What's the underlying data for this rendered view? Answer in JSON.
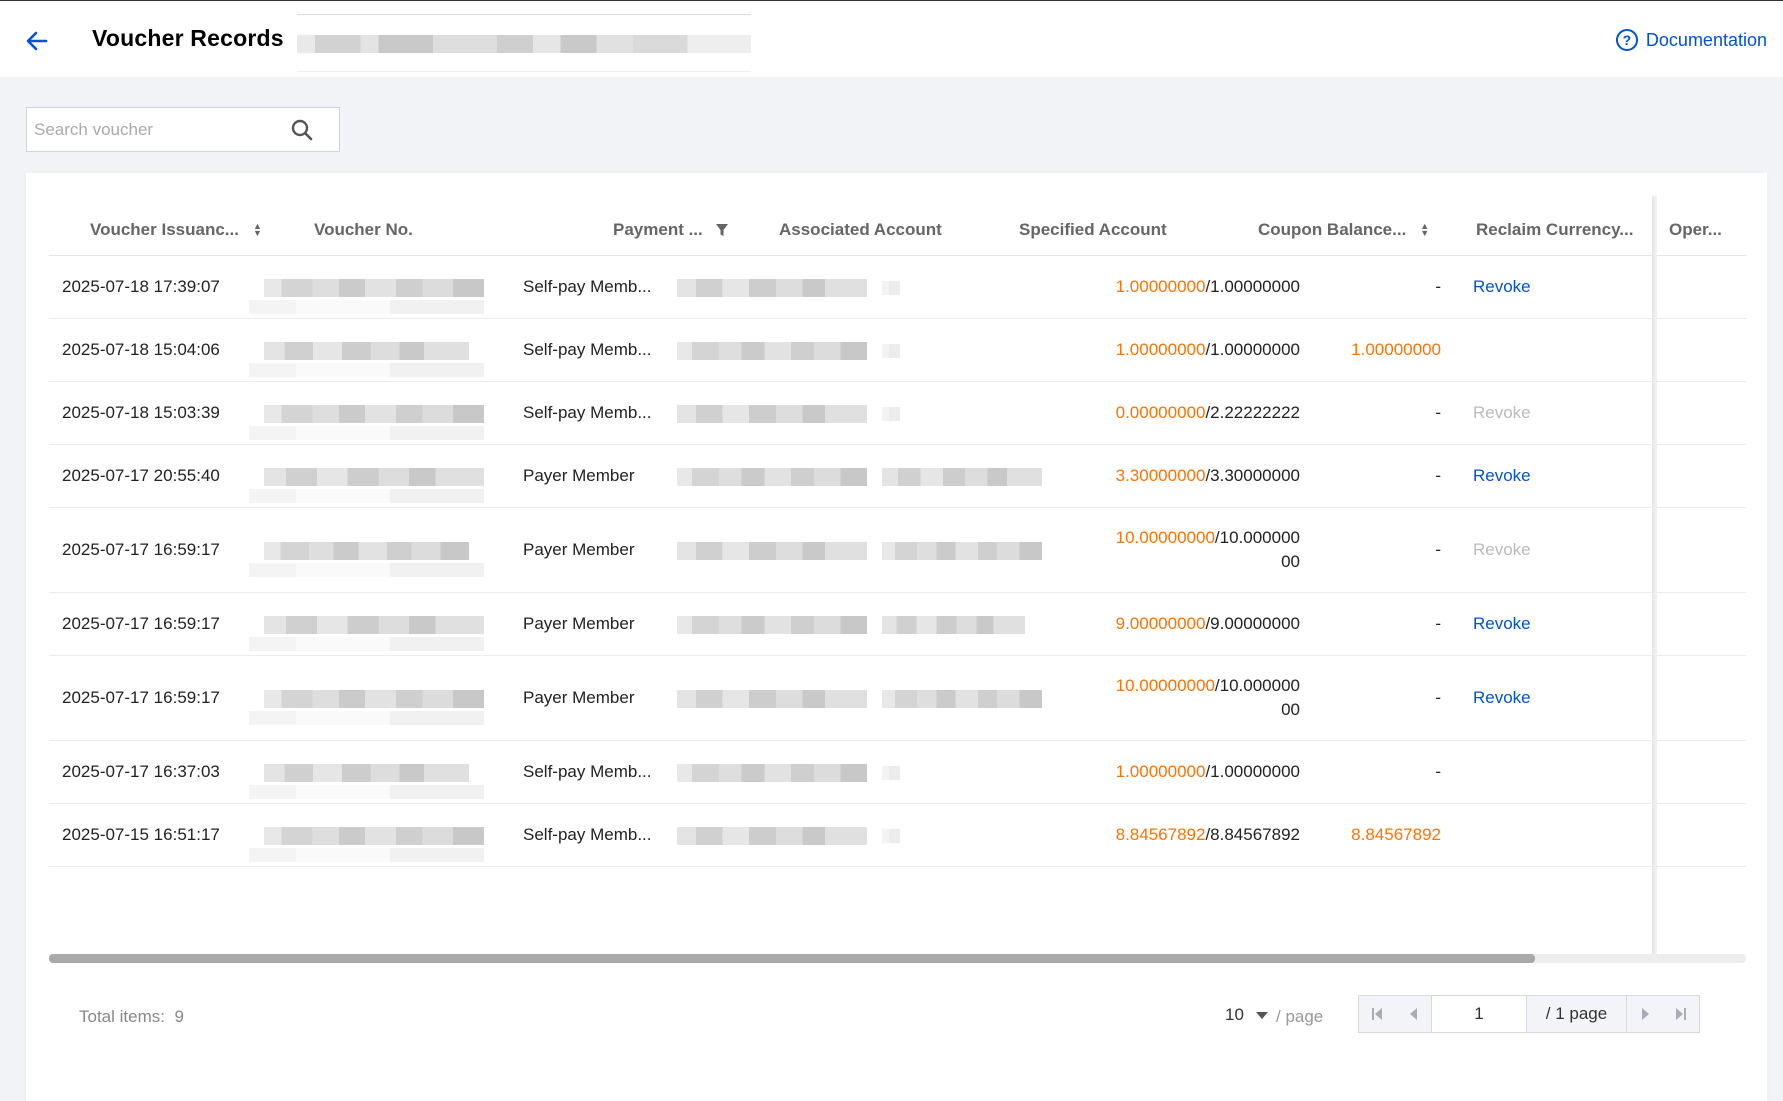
{
  "header": {
    "title": "Voucher Records",
    "doc_label": "Documentation",
    "doc_icon": "question-circle-icon"
  },
  "search": {
    "placeholder": "Search voucher",
    "value": ""
  },
  "table": {
    "columns": [
      {
        "label": "Voucher Issuanc...",
        "sortable": true
      },
      {
        "label": "Voucher No."
      },
      {
        "label": "Payment ...",
        "filterable": true
      },
      {
        "label": "Associated Account"
      },
      {
        "label": "Specified Account"
      },
      {
        "label": "Coupon Balance...",
        "sortable": true
      },
      {
        "label": "Reclaim Currency..."
      },
      {
        "label": "Oper..."
      }
    ],
    "rows": [
      {
        "time": "2025-07-18 17:39:07",
        "payment": "Self-pay Memb...",
        "balance_cur": "1.00000000",
        "balance_total_1": "/1.00000000",
        "balance_total_2": "",
        "reclaim": "-",
        "reclaim_orange": false,
        "action": "Revoke",
        "action_state": "active"
      },
      {
        "time": "2025-07-18 15:04:06",
        "payment": "Self-pay Memb...",
        "balance_cur": "1.00000000",
        "balance_total_1": "/1.00000000",
        "balance_total_2": "",
        "reclaim": "1.00000000",
        "reclaim_orange": true,
        "action": "",
        "action_state": "none"
      },
      {
        "time": "2025-07-18 15:03:39",
        "payment": "Self-pay Memb...",
        "balance_cur": "0.00000000",
        "balance_total_1": "/2.22222222",
        "balance_total_2": "",
        "reclaim": "-",
        "reclaim_orange": false,
        "action": "Revoke",
        "action_state": "disabled"
      },
      {
        "time": "2025-07-17 20:55:40",
        "payment": "Payer Member",
        "balance_cur": "3.30000000",
        "balance_total_1": "/3.30000000",
        "balance_total_2": "",
        "reclaim": "-",
        "reclaim_orange": false,
        "action": "Revoke",
        "action_state": "active"
      },
      {
        "time": "2025-07-17 16:59:17",
        "payment": "Payer Member",
        "balance_cur": "10.00000000",
        "balance_total_1": "/10.000000",
        "balance_total_2": "00",
        "reclaim": "-",
        "reclaim_orange": false,
        "action": "Revoke",
        "action_state": "disabled"
      },
      {
        "time": "2025-07-17 16:59:17",
        "payment": "Payer Member",
        "balance_cur": "9.00000000",
        "balance_total_1": "/9.00000000",
        "balance_total_2": "",
        "reclaim": "-",
        "reclaim_orange": false,
        "action": "Revoke",
        "action_state": "active"
      },
      {
        "time": "2025-07-17 16:59:17",
        "payment": "Payer Member",
        "balance_cur": "10.00000000",
        "balance_total_1": "/10.000000",
        "balance_total_2": "00",
        "reclaim": "-",
        "reclaim_orange": false,
        "action": "Revoke",
        "action_state": "active"
      },
      {
        "time": "2025-07-17 16:37:03",
        "payment": "Self-pay Memb...",
        "balance_cur": "1.00000000",
        "balance_total_1": "/1.00000000",
        "balance_total_2": "",
        "reclaim": "-",
        "reclaim_orange": false,
        "action": "",
        "action_state": "none"
      },
      {
        "time": "2025-07-15 16:51:17",
        "payment": "Self-pay Memb...",
        "balance_cur": "8.84567892",
        "balance_total_1": "/8.84567892",
        "balance_total_2": "",
        "reclaim": "8.84567892",
        "reclaim_orange": true,
        "action": "",
        "action_state": "none"
      }
    ]
  },
  "pagination": {
    "total_label": "Total items:",
    "total_value": "9",
    "page_size": "10",
    "per_page_label": "/ page",
    "current_page": "1",
    "total_pages_label": "/ 1 page"
  },
  "colors": {
    "accent": "#0052d9",
    "orange": "#ff7200",
    "disabled": "#bbbbbb"
  }
}
